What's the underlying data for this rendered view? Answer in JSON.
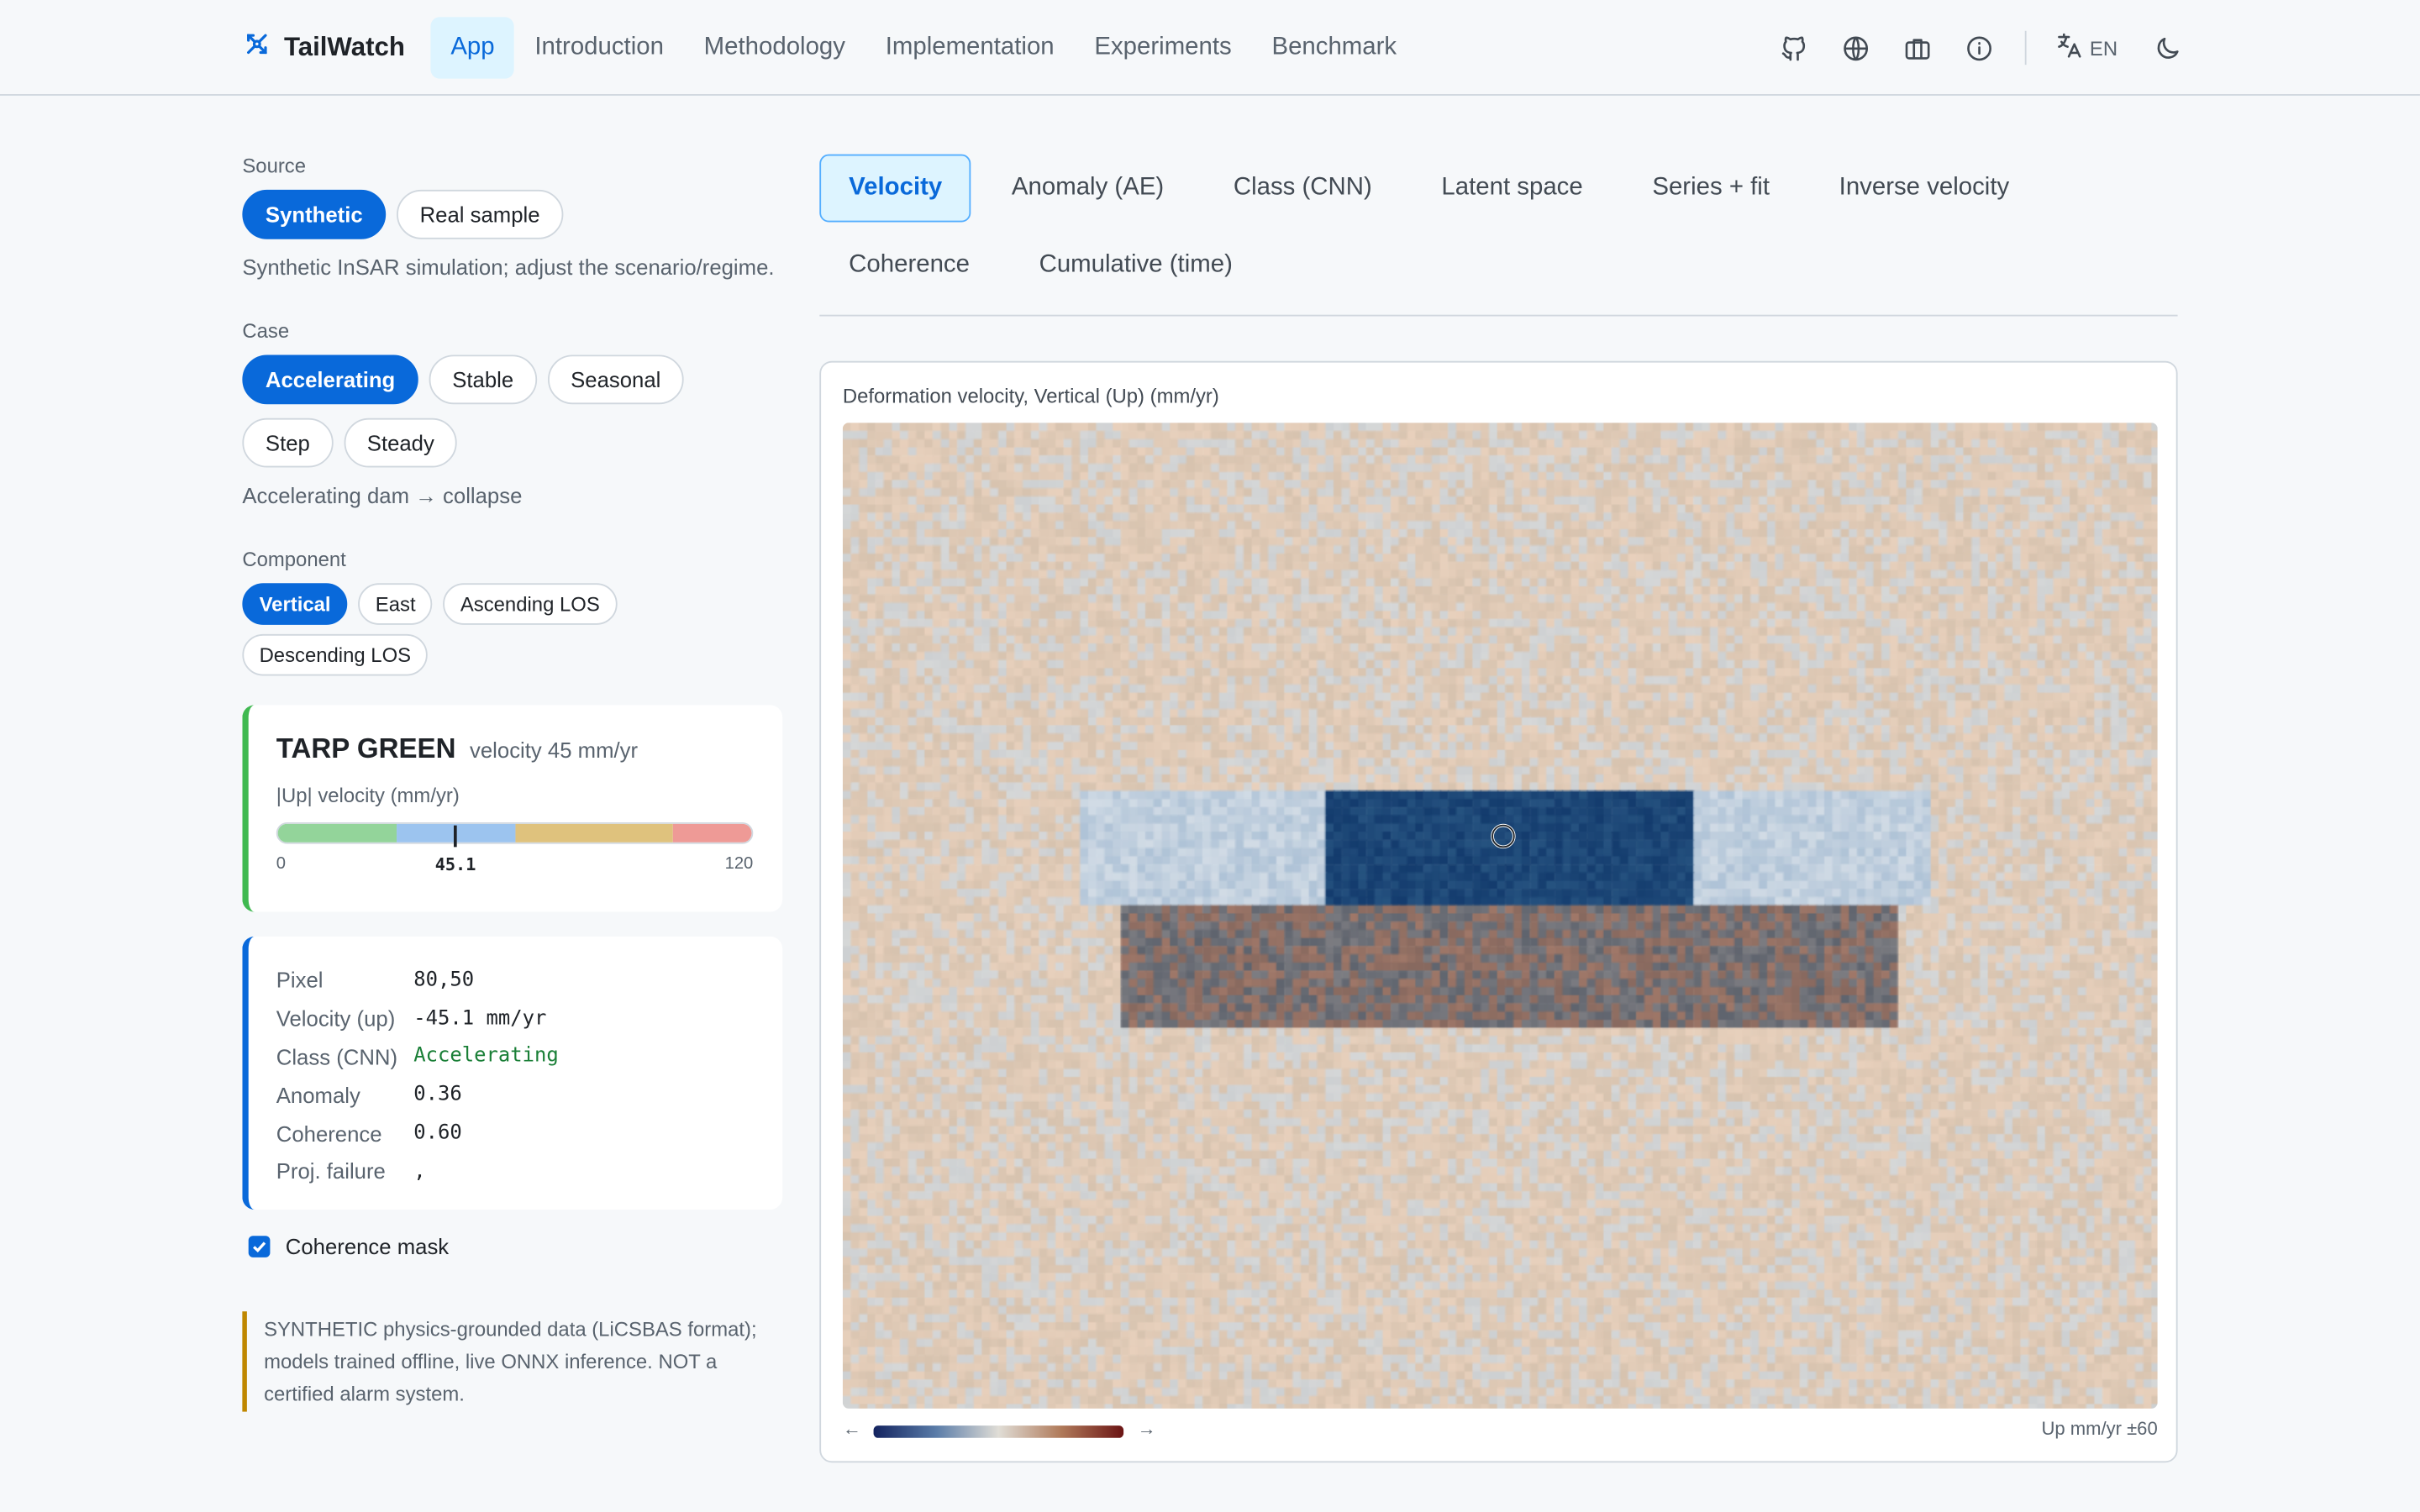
{
  "header": {
    "brand": "TailWatch",
    "nav": [
      {
        "label": "App",
        "active": true
      },
      {
        "label": "Introduction"
      },
      {
        "label": "Methodology"
      },
      {
        "label": "Implementation"
      },
      {
        "label": "Experiments"
      },
      {
        "label": "Benchmark"
      }
    ],
    "lang": "EN",
    "icons": [
      "github-icon",
      "globe-icon",
      "briefcase-icon",
      "info-icon",
      "translate-icon",
      "moon-icon"
    ]
  },
  "sidebar": {
    "source": {
      "label": "Source",
      "options": [
        "Synthetic",
        "Real sample"
      ],
      "selected": "Synthetic",
      "help": "Synthetic InSAR simulation; adjust the scenario/regime."
    },
    "case": {
      "label": "Case",
      "options": [
        "Accelerating",
        "Stable",
        "Seasonal",
        "Step",
        "Steady"
      ],
      "selected": "Accelerating",
      "help": "Accelerating dam → collapse"
    },
    "component": {
      "label": "Component",
      "options": [
        "Vertical",
        "East",
        "Ascending LOS",
        "Descending LOS"
      ],
      "selected": "Vertical"
    },
    "tarp": {
      "name": "TARP GREEN",
      "velocity_text": "velocity 45 mm/yr",
      "gauge_label": "|Up| velocity (mm/yr)",
      "min": "0",
      "max": "120",
      "value": "45.1",
      "value_num": 45.1,
      "range_num": 120,
      "segments": [
        {
          "to": 30,
          "color": "#93d49a"
        },
        {
          "to": 60,
          "color": "#9cc4ef"
        },
        {
          "to": 100,
          "color": "#dfc27d"
        },
        {
          "to": 120,
          "color": "#ee9a96"
        }
      ]
    },
    "info": [
      {
        "k": "Pixel",
        "v": "80,50"
      },
      {
        "k": "Velocity (up)",
        "v": "-45.1 mm/yr"
      },
      {
        "k": "Class (CNN)",
        "v": "Accelerating",
        "accent": true
      },
      {
        "k": "Anomaly",
        "v": "0.36"
      },
      {
        "k": "Coherence",
        "v": "0.60"
      },
      {
        "k": "Proj. failure",
        "v": ","
      }
    ],
    "mask_label": "Coherence mask",
    "mask_checked": true,
    "note": "SYNTHETIC physics-grounded data (LiCSBAS format); models trained offline, live ONNX inference. NOT a certified alarm system."
  },
  "main": {
    "tabs": [
      "Velocity",
      "Anomaly (AE)",
      "Class (CNN)",
      "Latent space",
      "Series + fit",
      "Inverse velocity",
      "Coherence",
      "Cumulative (time)"
    ],
    "active_tab": "Velocity",
    "map_title": "Deformation velocity, Vertical (Up) (mm/yr)",
    "legend_left": "←",
    "legend_right_arrow": "→",
    "legend_unit": "Up mm/yr ±60"
  }
}
